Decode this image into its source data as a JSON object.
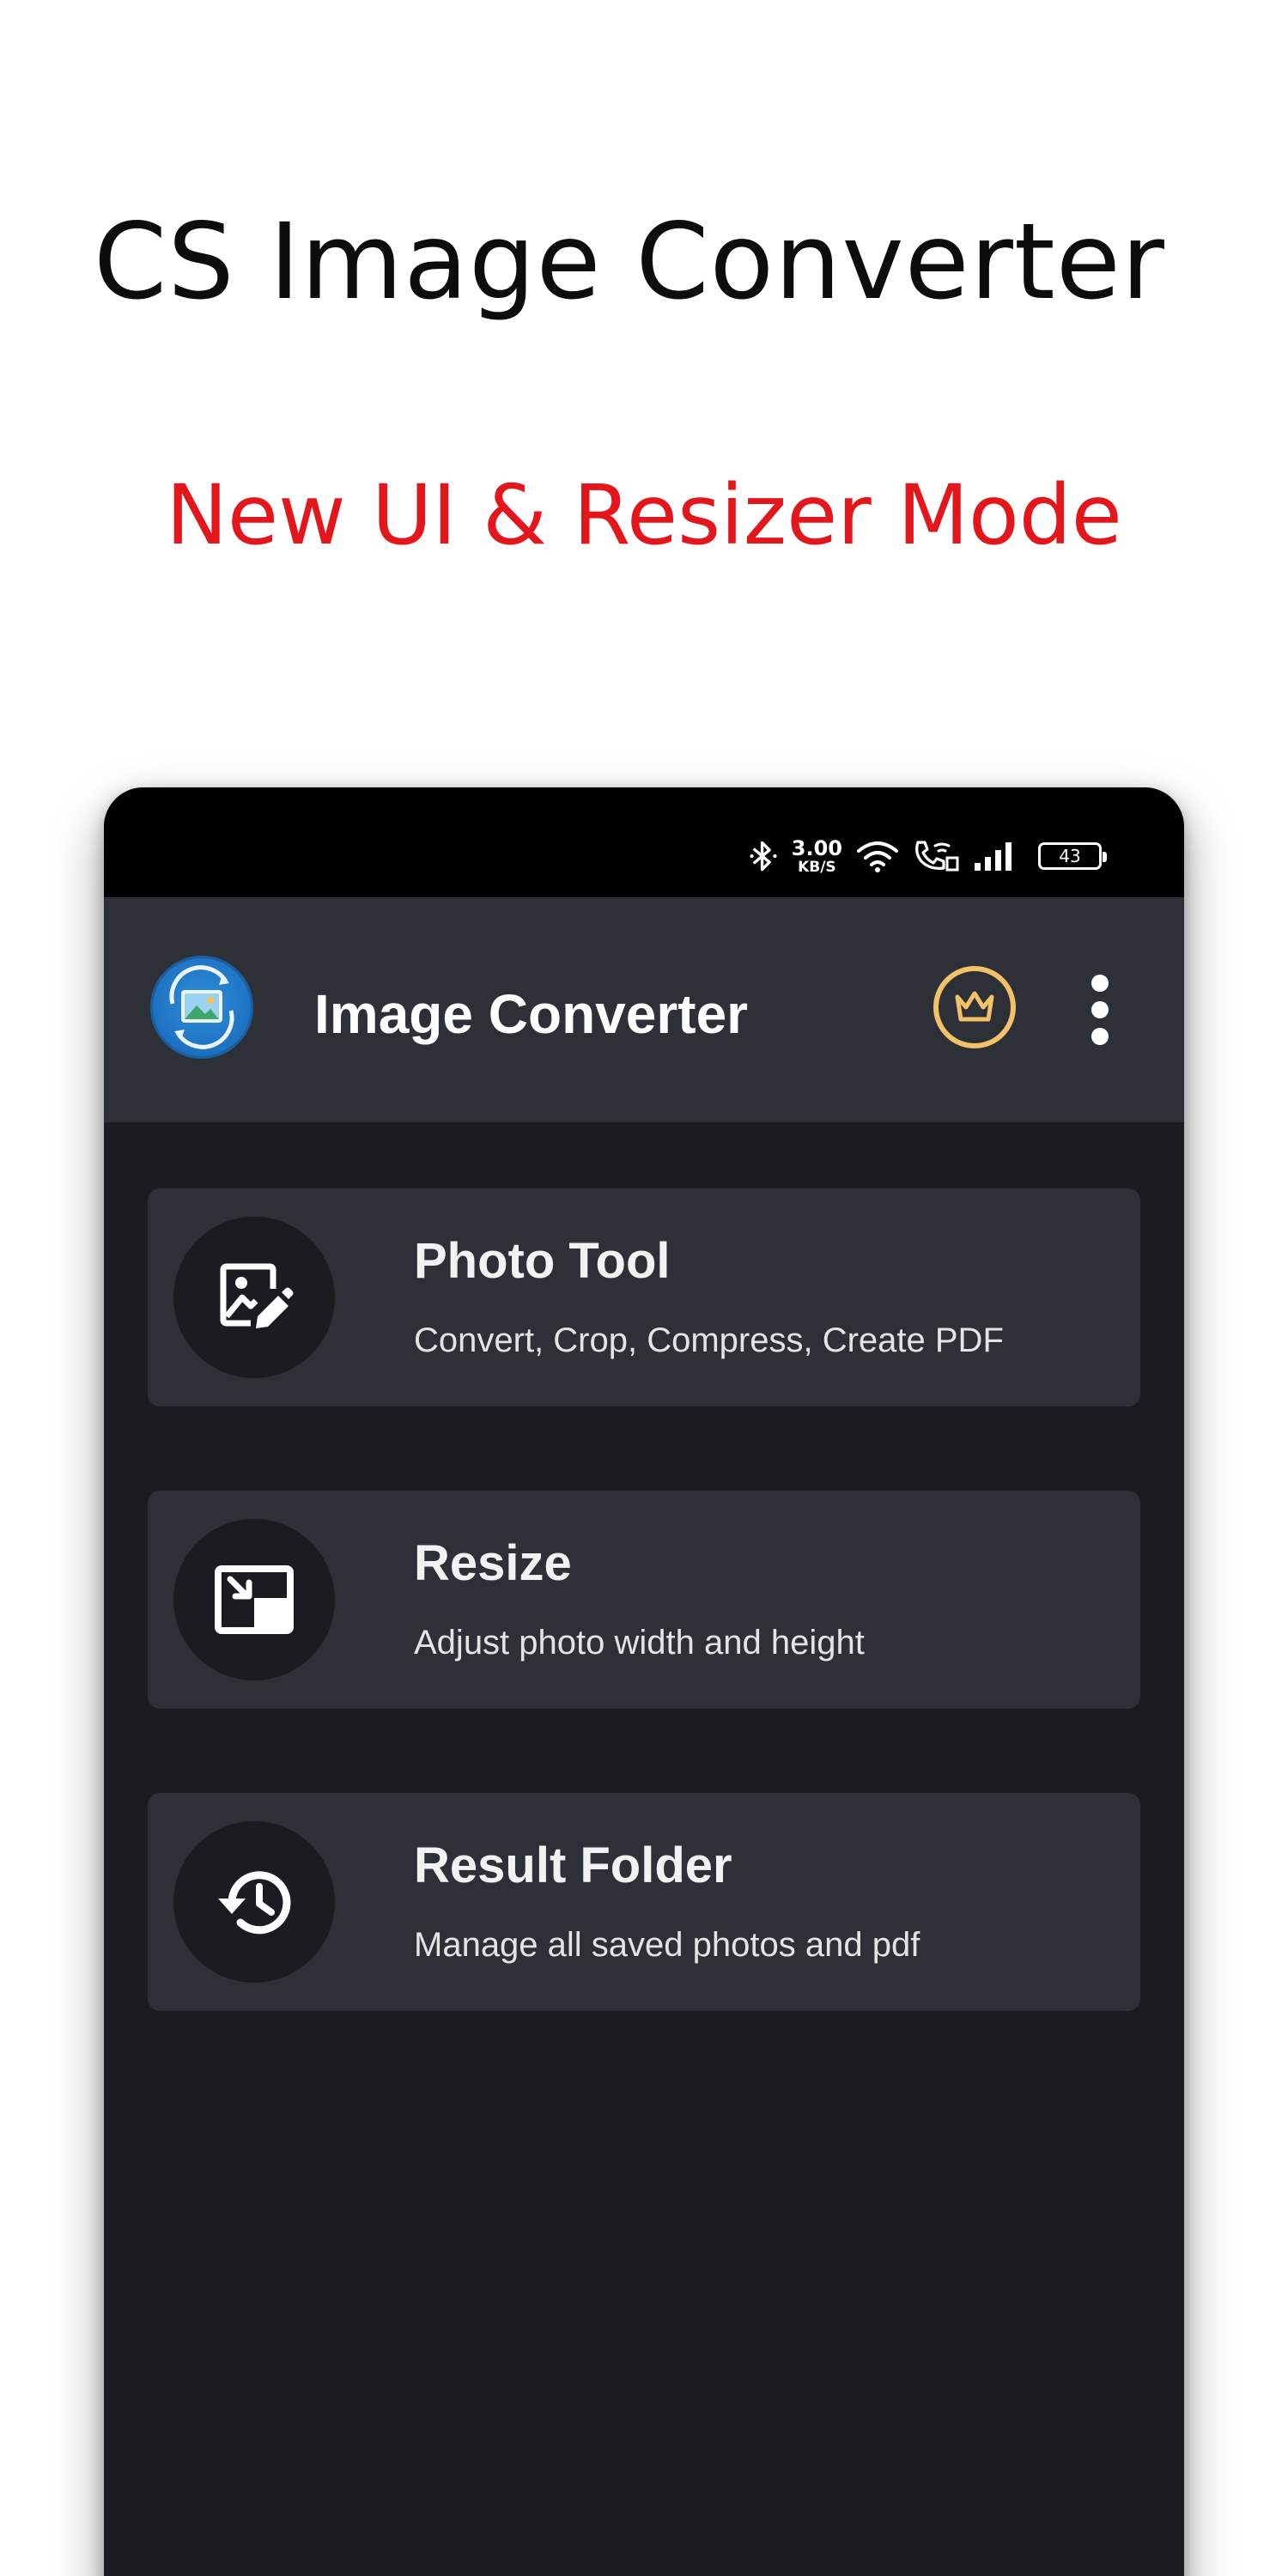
{
  "promo": {
    "title": "CS Image Converter",
    "subtitle": "New UI & Resizer Mode"
  },
  "status_bar": {
    "net_speed_value": "3.00",
    "net_speed_unit": "KB/S",
    "battery": "43",
    "icons": [
      "bluetooth-icon",
      "wifi-icon",
      "wifi-calling-icon",
      "signal-icon",
      "battery-icon"
    ]
  },
  "app_bar": {
    "title": "Image Converter",
    "logo_icon": "app-logo-icon",
    "premium_icon": "crown-icon",
    "more_icon": "more-vertical-icon"
  },
  "menu": [
    {
      "title": "Photo Tool",
      "description": "Convert, Crop, Compress, Create PDF",
      "icon": "photo-edit-icon"
    },
    {
      "title": "Resize",
      "description": "Adjust photo width and height",
      "icon": "resize-icon"
    },
    {
      "title": "Result Folder",
      "description": "Manage all saved photos and pdf",
      "icon": "history-icon"
    }
  ],
  "colors": {
    "subtitle": "#e3161c",
    "app_bar": "#2e3037",
    "screen_bg": "#1b1c20",
    "crown": "#f2c168"
  }
}
